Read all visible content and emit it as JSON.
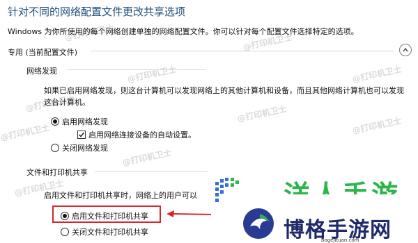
{
  "window": {
    "title": "针对不同的网络配置文件更改共享选项",
    "description": "Windows 为你所使用的每个网络创建单独的网络配置文件。你可以针对每个配置文件选择特定的选项。"
  },
  "profile_section": {
    "label": "专用 (当前配置文件)"
  },
  "network_discovery": {
    "heading": "网络发现",
    "paragraph": "如果已启用网络发现，则这台计算机可以发现网络上的其他计算机和设备，而且其他网络计算机也可以发现这台计算机。",
    "option_on": "启用网络发现",
    "auto_setup": "启用网络连接设备的自动设置。",
    "option_off": "关闭网络发现",
    "selected": "on",
    "auto_setup_checked": true
  },
  "file_sharing": {
    "heading": "文件和打印机共享",
    "paragraph": "启用文件和打印机共享时，网络上的用户可以",
    "option_on": "启用文件和打印机共享",
    "option_off": "关闭文件和打印机共享",
    "selected": "on"
  },
  "watermark": {
    "text": "@打印机卫士"
  },
  "logo": {
    "top_text": "洋人手游",
    "name": "博格手游网",
    "url": "bogejituan.com"
  },
  "colors": {
    "title": "#1f4e79",
    "highlight": "#d9262b",
    "logo_green": "#2bb64a",
    "logo_blue": "#1f2a6b"
  }
}
